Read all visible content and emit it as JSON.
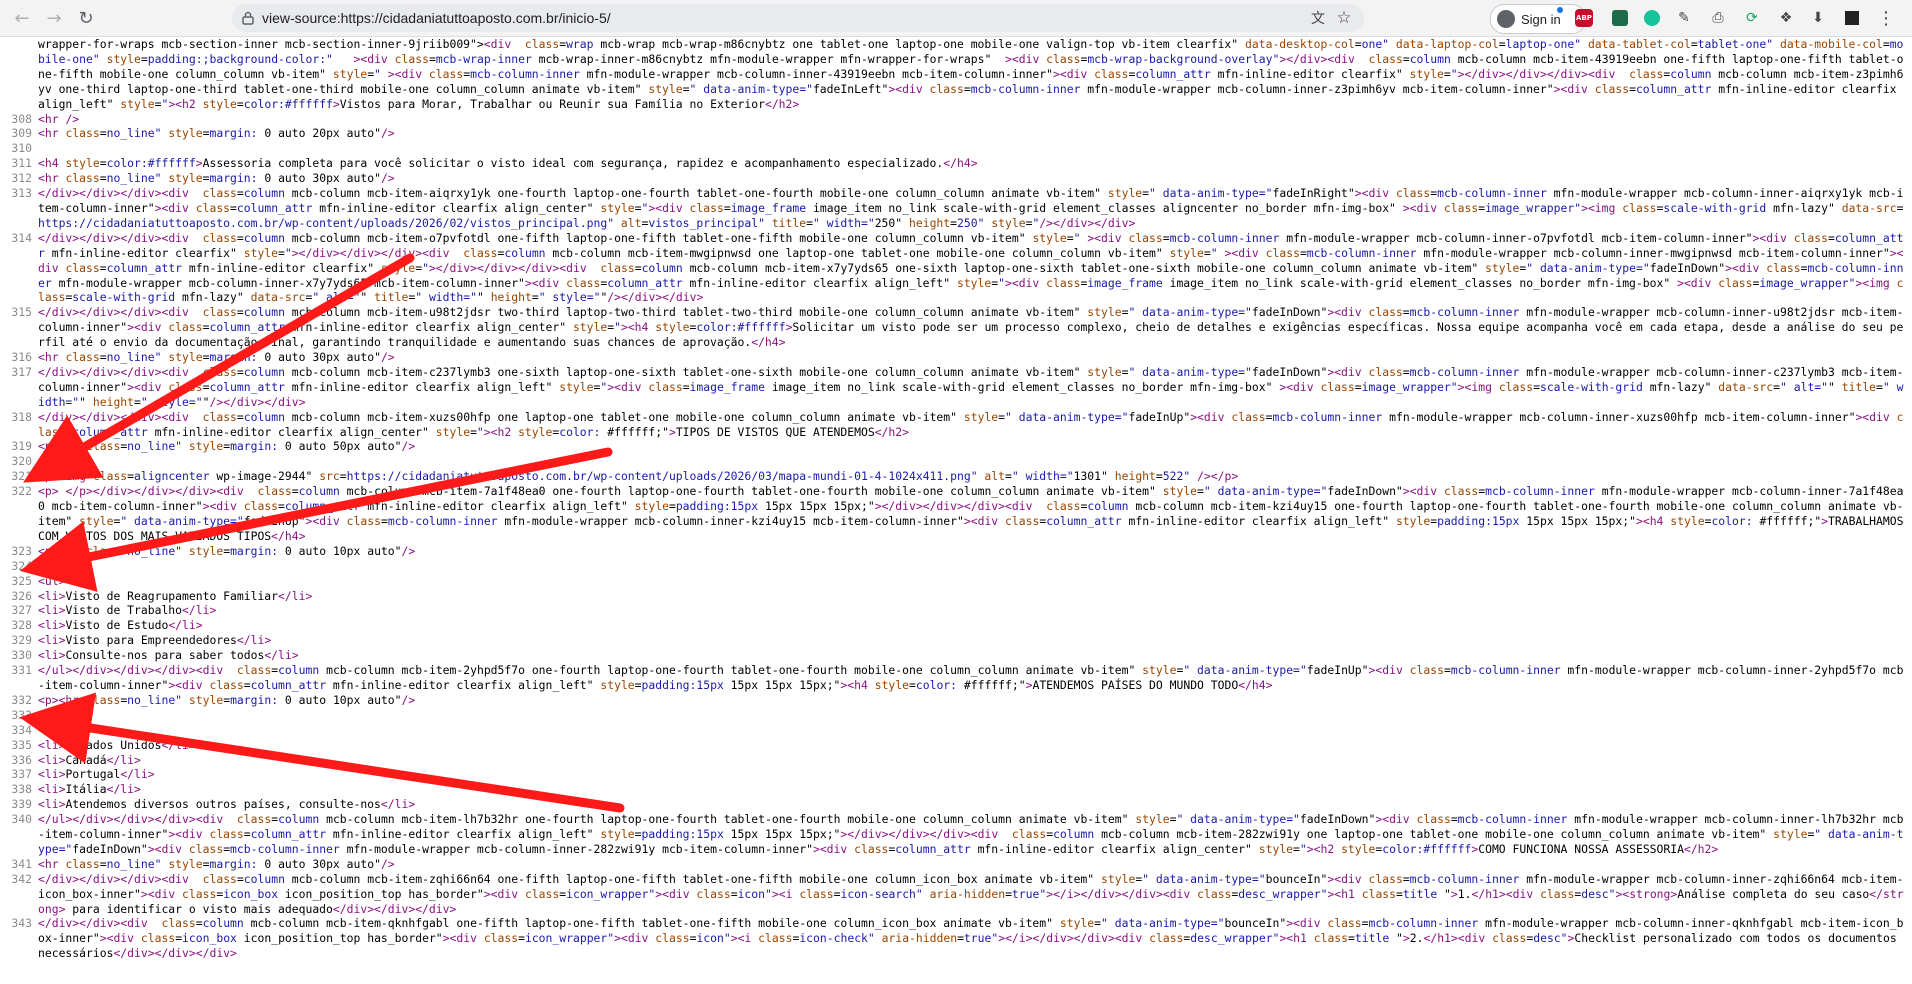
{
  "browser": {
    "url": "view-source:https://cidadaniatuttoaposto.com.br/inicio-5/",
    "signin_label": "Sign in",
    "extensions": [
      "ABP"
    ]
  },
  "annotation_color": "#ff1a1a",
  "source_lines": [
    {
      "n": "",
      "c": "wrapper-for-wraps mcb-section-inner mcb-section-inner-9jriib009\"><div  class=\"wrap mcb-wrap mcb-wrap-m86cnybtz one tablet-one laptop-one mobile-one valign-top vb-item clearfix\" data-desktop-col=\"one\" data-laptop-col=\"laptop-one\" data-tablet-col=\"tablet-one\" data-mobile-col=\"mobile-one\" style=\"padding:;background-color:\"   ><div class=\"mcb-wrap-inner mcb-wrap-inner-m86cnybtz mfn-module-wrapper mfn-wrapper-for-wraps\"  ><div class=\"mcb-wrap-background-overlay\"></div><div  class=\"column mcb-column mcb-item-43919eebn one-fifth laptop-one-fifth tablet-one-fifth mobile-one column_column vb-item\" style=\"\" ><div class=\"mcb-column-inner mfn-module-wrapper mcb-column-inner-43919eebn mcb-item-column-inner\"><div class=\"column_attr mfn-inline-editor clearfix\" style=\"\"></div></div></div><div  class=\"column mcb-column mcb-item-z3pimh6yv one-third laptop-one-third tablet-one-third mobile-one column_column animate vb-item\" style=\"\" data-anim-type=\"fadeInLeft\"><div class=\"mcb-column-inner mfn-module-wrapper mcb-column-inner-z3pimh6yv mcb-item-column-inner\"><div class=\"column_attr mfn-inline-editor clearfix align_left\" style=\"\"><h2 style=color:#ffffff>Vistos para Morar, Trabalhar ou Reunir sua Família no Exterior</h2>"
    },
    {
      "n": "308",
      "c": "<hr />"
    },
    {
      "n": "309",
      "c": "<hr class=\"no_line\" style=\"margin: 0 auto 20px auto\"/>"
    },
    {
      "n": "310",
      "c": ""
    },
    {
      "n": "311",
      "c": "<h4 style=color:#ffffff>Assessoria completa para você solicitar o visto ideal com segurança, rapidez e acompanhamento especializado.</h4>"
    },
    {
      "n": "312",
      "c": "<hr class=\"no_line\" style=\"margin: 0 auto 30px auto\"/>"
    },
    {
      "n": "313",
      "c": "</div></div></div><div  class=\"column mcb-column mcb-item-aiqrxy1yk one-fourth laptop-one-fourth tablet-one-fourth mobile-one column_column animate vb-item\" style=\"\" data-anim-type=\"fadeInRight\"><div class=\"mcb-column-inner mfn-module-wrapper mcb-column-inner-aiqrxy1yk mcb-item-column-inner\"><div class=\"column_attr mfn-inline-editor clearfix align_center\" style=\"\"><div class=\"image_frame image_item no_link scale-with-grid element_classes aligncenter no_border mfn-img-box\" ><div class=\"image_wrapper\"><img class=\"scale-with-grid mfn-lazy\" data-src=\"https://cidadaniatuttoaposto.com.br/wp-content/uploads/2026/02/vistos_principal.png\" alt=\"vistos_principal\" title=\"\" width=\"250\" height=\"250\" style=\"\"/></div></div>"
    },
    {
      "n": "314",
      "c": "</div></div></div><div  class=\"column mcb-column mcb-item-o7pvfotdl one-fifth laptop-one-fifth tablet-one-fifth mobile-one column_column vb-item\" style=\"\" ><div class=\"mcb-column-inner mfn-module-wrapper mcb-column-inner-o7pvfotdl mcb-item-column-inner\"><div class=\"column_attr mfn-inline-editor clearfix\" style=\"\"></div></div></div><div  class=\"column mcb-column mcb-item-mwgipnwsd one laptop-one tablet-one mobile-one column_column vb-item\" style=\"\" ><div class=\"mcb-column-inner mfn-module-wrapper mcb-column-inner-mwgipnwsd mcb-item-column-inner\"><div class=\"column_attr mfn-inline-editor clearfix\" style=\"\"></div></div></div><div  class=\"column mcb-column mcb-item-x7y7yds65 one-sixth laptop-one-sixth tablet-one-sixth mobile-one column_column animate vb-item\" style=\"\" data-anim-type=\"fadeInDown\"><div class=\"mcb-column-inner mfn-module-wrapper mcb-column-inner-x7y7yds65 mcb-item-column-inner\"><div class=\"column_attr mfn-inline-editor clearfix align_left\" style=\"\"><div class=\"image_frame image_item no_link scale-with-grid element_classes no_border mfn-img-box\" ><div class=\"image_wrapper\"><img class=\"scale-with-grid mfn-lazy\" data-src=\"\" alt=\"\" title=\"\" width=\"\" height=\"\" style=\"\"/></div></div>"
    },
    {
      "n": "315",
      "c": "</div></div></div><div  class=\"column mcb-column mcb-item-u98t2jdsr two-third laptop-two-third tablet-two-third mobile-one column_column animate vb-item\" style=\"\" data-anim-type=\"fadeInDown\"><div class=\"mcb-column-inner mfn-module-wrapper mcb-column-inner-u98t2jdsr mcb-item-column-inner\"><div class=\"column_attr mfn-inline-editor clearfix align_center\" style=\"\"><h4 style=color:#ffffff>Solicitar um visto pode ser um processo complexo, cheio de detalhes e exigências específicas. Nossa equipe acompanha você em cada etapa, desde a análise do seu perfil até o envio da documentação final, garantindo tranquilidade e aumentando suas chances de aprovação.</h4>"
    },
    {
      "n": "316",
      "c": "<hr class=\"no_line\" style=\"margin: 0 auto 30px auto\"/>"
    },
    {
      "n": "317",
      "c": "</div></div></div><div  class=\"column mcb-column mcb-item-c237lymb3 one-sixth laptop-one-sixth tablet-one-sixth mobile-one column_column animate vb-item\" style=\"\" data-anim-type=\"fadeInDown\"><div class=\"mcb-column-inner mfn-module-wrapper mcb-column-inner-c237lymb3 mcb-item-column-inner\"><div class=\"column_attr mfn-inline-editor clearfix align_left\" style=\"\"><div class=\"image_frame image_item no_link scale-with-grid element_classes no_border mfn-img-box\" ><div class=\"image_wrapper\"><img class=\"scale-with-grid mfn-lazy\" data-src=\"\" alt=\"\" title=\"\" width=\"\" height=\"\" style=\"\"/></div></div>"
    },
    {
      "n": "318",
      "c": "</div></div></div><div  class=\"column mcb-column mcb-item-xuzs00hfp one laptop-one tablet-one mobile-one column_column animate vb-item\" style=\"\" data-anim-type=\"fadeInUp\"><div class=\"mcb-column-inner mfn-module-wrapper mcb-column-inner-xuzs00hfp mcb-item-column-inner\"><div class=\"column_attr mfn-inline-editor clearfix align_center\" style=\"\"><h2 style=\"color: #ffffff;\">TIPOS DE VISTOS QUE ATENDEMOS</h2>"
    },
    {
      "n": "319",
      "c": "<p><hr class=\"no_line\" style=\"margin: 0 auto 50px auto\"/>"
    },
    {
      "n": "320",
      "c": "</p>"
    },
    {
      "n": "321",
      "c": "<p><img class=\"aligncenter wp-image-2944\" src=\"https://cidadaniatuttoaposto.com.br/wp-content/uploads/2026/03/mapa-mundi-01-4-1024x411.png\" alt=\"\" width=\"1301\" height=\"522\" /></p>"
    },
    {
      "n": "322",
      "c": "<p> </p></div></div></div><div  class=\"column mcb-column mcb-item-7a1f48ea0 one-fourth laptop-one-fourth tablet-one-fourth mobile-one column_column animate vb-item\" style=\"\" data-anim-type=\"fadeInDown\"><div class=\"mcb-column-inner mfn-module-wrapper mcb-column-inner-7a1f48ea0 mcb-item-column-inner\"><div class=\"column_attr mfn-inline-editor clearfix align_left\" style=\"padding:15px 15px 15px 15px;\"></div></div></div><div  class=\"column mcb-column mcb-item-kzi4uy15 one-fourth laptop-one-fourth tablet-one-fourth mobile-one column_column animate vb-item\" style=\"\" data-anim-type=\"fadeInUp\"><div class=\"mcb-column-inner mfn-module-wrapper mcb-column-inner-kzi4uy15 mcb-item-column-inner\"><div class=\"column_attr mfn-inline-editor clearfix align_left\" style=\"padding:15px 15px 15px 15px;\"><h4 style=\"color: #ffffff;\">TRABALHAMOS COM VISTOS DOS MAIS VARIADOS TIPOS</h4>"
    },
    {
      "n": "323",
      "c": "<p><hr class=\"no_line\" style=\"margin: 0 auto 10px auto\"/>"
    },
    {
      "n": "324",
      "c": "</p>"
    },
    {
      "n": "325",
      "c": "<ul>"
    },
    {
      "n": "326",
      "c": "<li>Visto de Reagrupamento Familiar</li>"
    },
    {
      "n": "327",
      "c": "<li>Visto de Trabalho</li>"
    },
    {
      "n": "328",
      "c": "<li>Visto de Estudo</li>"
    },
    {
      "n": "329",
      "c": "<li>Visto para Empreendedores</li>"
    },
    {
      "n": "330",
      "c": "<li>Consulte-nos para saber todos</li>"
    },
    {
      "n": "331",
      "c": "</ul></div></div></div><div  class=\"column mcb-column mcb-item-2yhpd5f7o one-fourth laptop-one-fourth tablet-one-fourth mobile-one column_column animate vb-item\" style=\"\" data-anim-type=\"fadeInUp\"><div class=\"mcb-column-inner mfn-module-wrapper mcb-column-inner-2yhpd5f7o mcb-item-column-inner\"><div class=\"column_attr mfn-inline-editor clearfix align_left\" style=\"padding:15px 15px 15px 15px;\"><h4 style=\"color: #ffffff;\">ATENDEMOS PAÍSES DO MUNDO TODO</h4>"
    },
    {
      "n": "332",
      "c": "<p><hr class=\"no_line\" style=\"margin: 0 auto 10px auto\"/>"
    },
    {
      "n": "333",
      "c": "</p>"
    },
    {
      "n": "334",
      "c": "<ul>"
    },
    {
      "n": "335",
      "c": "<li>Estados Unidos</li>"
    },
    {
      "n": "336",
      "c": "<li>Canadá</li>"
    },
    {
      "n": "337",
      "c": "<li>Portugal</li>"
    },
    {
      "n": "338",
      "c": "<li>Itália</li>"
    },
    {
      "n": "339",
      "c": "<li>Atendemos diversos outros países, consulte-nos</li>"
    },
    {
      "n": "340",
      "c": "</ul></div></div></div><div  class=\"column mcb-column mcb-item-lh7b32hr one-fourth laptop-one-fourth tablet-one-fourth mobile-one column_column animate vb-item\" style=\"\" data-anim-type=\"fadeInDown\"><div class=\"mcb-column-inner mfn-module-wrapper mcb-column-inner-lh7b32hr mcb-item-column-inner\"><div class=\"column_attr mfn-inline-editor clearfix align_left\" style=\"padding:15px 15px 15px 15px;\"></div></div></div><div  class=\"column mcb-column mcb-item-282zwi91y one laptop-one tablet-one mobile-one column_column animate vb-item\" style=\"\" data-anim-type=\"fadeInDown\"><div class=\"mcb-column-inner mfn-module-wrapper mcb-column-inner-282zwi91y mcb-item-column-inner\"><div class=\"column_attr mfn-inline-editor clearfix align_center\" style=\"\"><h2 style=color:#ffffff>COMO FUNCIONA NOSSA ASSESSORIA</h2>"
    },
    {
      "n": "341",
      "c": "<hr class=\"no_line\" style=\"margin: 0 auto 30px auto\"/>"
    },
    {
      "n": "342",
      "c": "</div></div></div><div  class=\"column mcb-column mcb-item-zqhi66n64 one-fifth laptop-one-fifth tablet-one-fifth mobile-one column_icon_box animate vb-item\" style=\"\" data-anim-type=\"bounceIn\"><div class=\"mcb-column-inner mfn-module-wrapper mcb-column-inner-zqhi66n64 mcb-item-icon_box-inner\"><div class=\"icon_box icon_position_top has_border\"><div class=\"icon_wrapper\"><div class=\"icon\"><i class=\"icon-search\" aria-hidden=\"true\"></i></div></div><div class=\"desc_wrapper\"><h1 class=\"title \">1.</h1><div class=\"desc\"><strong>Análise completa do seu caso</strong> para identificar o visto mais adequado</div></div></div>"
    },
    {
      "n": "343",
      "c": "</div></div><div  class=\"column mcb-column mcb-item-qknhfgabl one-fifth laptop-one-fifth tablet-one-fifth mobile-one column_icon_box animate vb-item\" style=\"\" data-anim-type=\"bounceIn\"><div class=\"mcb-column-inner mfn-module-wrapper mcb-column-inner-qknhfgabl mcb-item-icon_box-inner\"><div class=\"icon_box icon_position_top has_border\"><div class=\"icon_wrapper\"><div class=\"icon\"><i class=\"icon-check\" aria-hidden=\"true\"></i></div></div><div class=\"desc_wrapper\"><h1 class=\"title \">2.</h1><div class=\"desc\">Checklist personalizado com todos os documentos necessários</div></div></div>"
    }
  ]
}
